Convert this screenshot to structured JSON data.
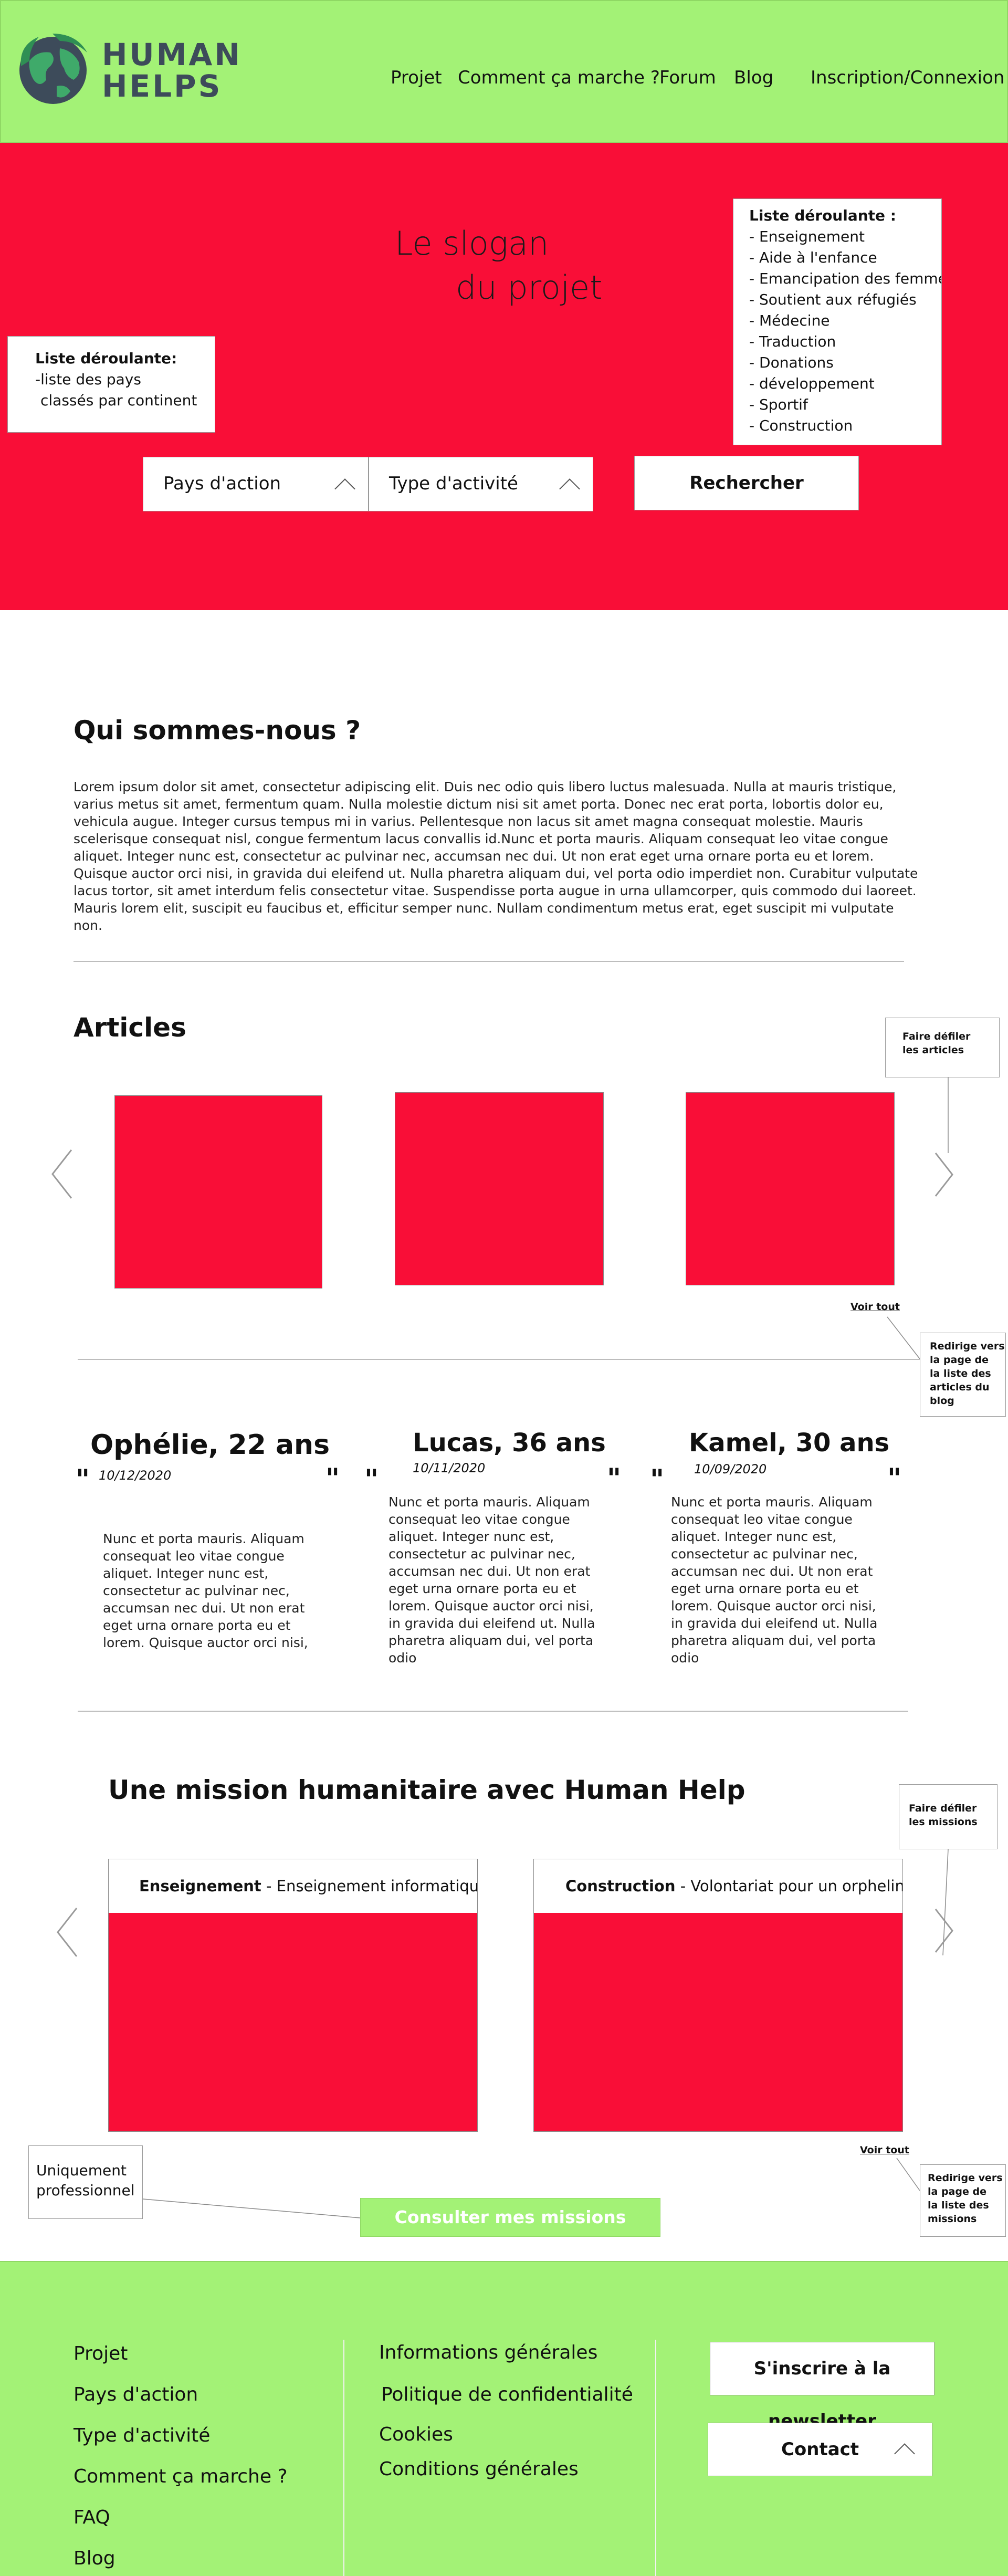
{
  "header": {
    "logo_line1": "HUMAN",
    "logo_line2": "HELPS",
    "nav": [
      "Projet",
      "Comment ça marche ?",
      "Forum",
      "Blog"
    ],
    "login": "Inscription/Connexion"
  },
  "hero": {
    "slogan_line1": "Le slogan",
    "slogan_line2": "du projet",
    "note_pays": {
      "title": "Liste déroulante:",
      "lines": [
        "-liste des pays",
        "classés par continent"
      ]
    },
    "note_type": {
      "title": "Liste déroulante :",
      "items": [
        "- Enseignement",
        "- Aide à l'enfance",
        "- Emancipation des femmes",
        "- Soutient aux réfugiés",
        "- Médecine",
        "- Traduction",
        "- Donations",
        "- développement",
        "- Sportif",
        "- Construction"
      ]
    },
    "dropdown_pays": "Pays d'action",
    "dropdown_type": "Type d'activité",
    "search_button": "Rechercher"
  },
  "about": {
    "title": "Qui sommes-nous ?",
    "text": "Lorem ipsum dolor sit amet, consectetur adipiscing elit. Duis nec odio quis libero luctus malesuada. Nulla at mauris tristique, varius metus sit amet, fermentum quam. Nulla molestie dictum nisi sit amet porta. Donec nec erat porta, lobortis dolor eu, vehicula augue. Integer cursus tempus mi in varius. Pellentesque non lacus sit amet magna consequat molestie. Mauris scelerisque consequat nisl, congue fermentum lacus convallis id.Nunc et porta mauris. Aliquam consequat leo vitae congue aliquet. Integer nunc est, consectetur ac pulvinar nec, accumsan nec dui. Ut non erat eget urna ornare porta eu et lorem. Quisque auctor orci nisi, in gravida dui eleifend ut. Nulla pharetra aliquam dui, vel porta odio imperdiet non. Curabitur vulputate lacus tortor, sit amet interdum felis consectetur vitae. Suspendisse porta augue in urna ullamcorper, quis commodo dui laoreet. Mauris lorem elit, suscipit eu faucibus et, efficitur semper nunc. Nullam condimentum metus erat, eget suscipit mi vulputate non."
  },
  "articles": {
    "title": "Articles",
    "scroll_note": [
      "Faire défiler",
      "les articles"
    ],
    "see_all": "Voir tout",
    "redirect_note": [
      "Redirige vers",
      "la page de",
      "la liste des",
      "articles du",
      "blog"
    ]
  },
  "testimonials": {
    "open_quote": "\"",
    "close_quote": "\"",
    "items": [
      {
        "name": "Ophélie, 22 ans",
        "date": "10/12/2020",
        "text": "Nunc et porta mauris. Aliquam consequat leo vitae congue aliquet. Integer nunc est, consectetur ac pulvinar nec, accumsan nec dui. Ut non erat eget urna ornare porta eu et lorem. Quisque auctor orci nisi,"
      },
      {
        "name": "Lucas, 36 ans",
        "date": "10/11/2020",
        "text": "Nunc et porta mauris. Aliquam consequat leo vitae congue aliquet. Integer nunc est, consectetur ac pulvinar nec, accumsan nec dui. Ut non erat eget urna ornare porta eu et lorem. Quisque auctor orci nisi, in gravida dui eleifend ut. Nulla pharetra aliquam dui, vel porta odio"
      },
      {
        "name": "Kamel, 30 ans",
        "date": "10/09/2020",
        "text": "Nunc et porta mauris. Aliquam consequat leo vitae congue aliquet. Integer nunc est, consectetur ac pulvinar nec, accumsan nec dui. Ut non erat eget urna ornare porta eu et lorem. Quisque auctor orci nisi, in gravida dui eleifend ut. Nulla pharetra aliquam dui, vel porta odio"
      }
    ]
  },
  "missions": {
    "title": "Une mission humanitaire avec Human Help",
    "scroll_note": [
      "Faire défiler",
      "les missions"
    ],
    "cards": [
      {
        "category": "Enseignement",
        "detail": " - Enseignement informatique"
      },
      {
        "category": "Construction",
        "detail": " - Volontariat pour un orphelinat"
      }
    ],
    "see_all": "Voir tout",
    "redirect_note": [
      "Redirige vers",
      "la page de",
      "la liste des",
      "missions"
    ],
    "pro_note": [
      "Uniquement",
      "professionnel"
    ],
    "consult_button": "Consulter mes missions"
  },
  "footer": {
    "col1": [
      "Projet",
      "Pays d'action",
      "Type d'activité",
      "Comment ça marche ?",
      "FAQ",
      "Blog"
    ],
    "col2": [
      "Informations générales",
      "Politique de confidentialité",
      "Cookies",
      "Conditions générales"
    ],
    "newsletter_button": "S'inscrire à la newsletter",
    "contact_button": "Contact"
  },
  "colors": {
    "green": "#a3f276",
    "red": "#f90e37",
    "logo_text": "#3d4b5a"
  },
  "icons": [
    "globe-logo-icon",
    "chevron-up-icon",
    "chevron-left-icon",
    "chevron-right-icon"
  ]
}
